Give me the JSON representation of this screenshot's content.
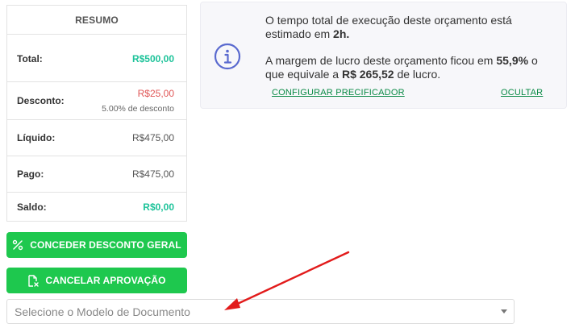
{
  "summary": {
    "title": "RESUMO",
    "rows": [
      {
        "label": "Total:",
        "value": "R$500,00"
      },
      {
        "label": "Desconto:",
        "value": "R$25,00",
        "sub": "5.00% de desconto"
      },
      {
        "label": "Líquido:",
        "value": "R$475,00"
      },
      {
        "label": "Pago:",
        "value": "R$475,00"
      },
      {
        "label": "Saldo:",
        "value": "R$0,00"
      }
    ]
  },
  "buttons": {
    "discount_label": "CONCEDER DESCONTO GERAL",
    "cancel_label": "CANCELAR APROVAÇÃO"
  },
  "info": {
    "line1_prefix": "O tempo total de execução deste orçamento está estimado em ",
    "time": "2h.",
    "line2_prefix": "A margem de lucro deste orçamento ficou em ",
    "margin": "55,9%",
    "line2_mid": " o que equivale a ",
    "profit": "R$ 265,52",
    "line2_suffix": " de lucro.",
    "configure_link": "CONFIGURAR PRECIFICADOR",
    "hide_link": "OCULTAR"
  },
  "document_select": {
    "placeholder": "Selecione o Modelo de Documento"
  },
  "colors": {
    "accent_green": "#1ec84e",
    "value_green": "#1ec39a",
    "value_red": "#e05656",
    "link_green": "#0a8a45",
    "info_icon": "#5a6acf",
    "annotation_arrow": "#e21b1b"
  },
  "icons": {
    "discount_button": "percent-icon",
    "cancel_button": "document-cancel-icon",
    "info_box": "info-icon",
    "select": "caret-down-icon",
    "annotation": "red-arrow-icon"
  }
}
